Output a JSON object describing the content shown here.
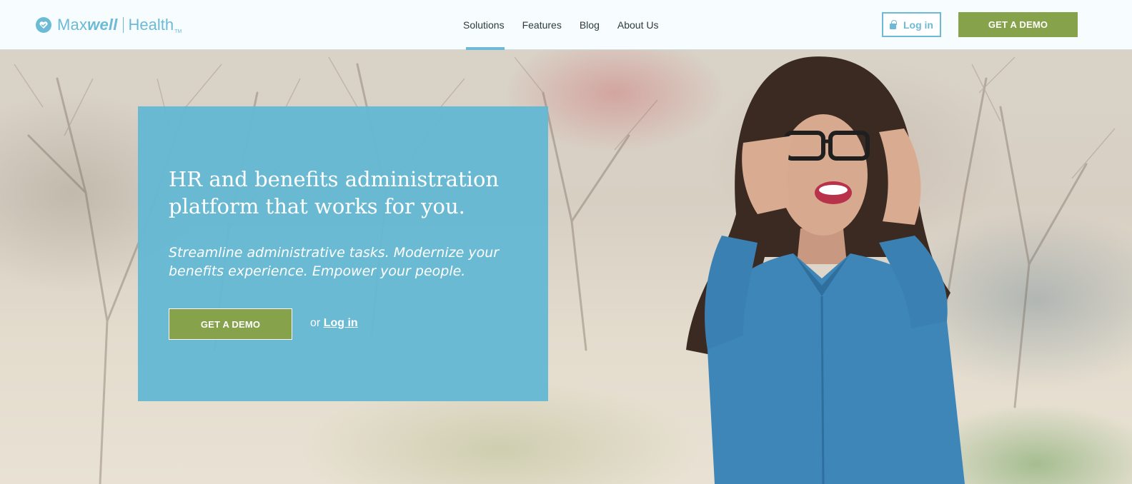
{
  "header": {
    "brand": {
      "name_light": "Max",
      "name_bold": "well",
      "name_suffix": "Health",
      "tm": "TM"
    },
    "nav": [
      {
        "label": "Solutions",
        "active": true
      },
      {
        "label": "Features",
        "active": false
      },
      {
        "label": "Blog",
        "active": false
      },
      {
        "label": "About Us",
        "active": false
      }
    ],
    "login_label": "Log in",
    "demo_label": "GET A DEMO"
  },
  "hero": {
    "title": "HR and benefits administration platform that works for you.",
    "subtitle": "Streamline administrative tasks. Modernize your benefits experience. Empower your people.",
    "cta_label": "GET A DEMO",
    "or_text": "or",
    "login_link": "Log in"
  },
  "colors": {
    "brand_blue": "#6cbad5",
    "cta_green": "#86a24a",
    "card_blue": "#65b8d3"
  },
  "icons": {
    "logo": "heart-check-icon",
    "login": "lock-icon"
  }
}
